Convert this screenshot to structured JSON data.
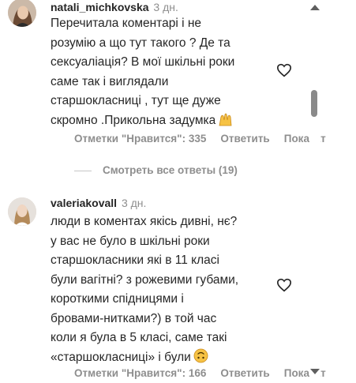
{
  "comments": [
    {
      "username": "natali_michkovska",
      "time": "3 дн.",
      "text": "Перечитала коментарі і не\nрозумію а що тут такого ? Де та\nсексуаліація? В мої шкільні роки\nсаме так і виглядали\nстаршокласниці , тут ще дуже\nскромно .Прикольна задумка",
      "emoji": "raised-hands",
      "likes_label": "Отметки \"Нравится\": 335",
      "reply_label": "Ответить",
      "show_label": "Показат"
    },
    {
      "username": "valeriakovall",
      "time": "3 дн.",
      "text": "люди в коментах якісь дивні, нє?\nу вас не було в шкільні роки\nстаршокласники які в 11 класі\nбули вагітні? з рожевими губами,\nкороткими спідницями і\nбровами-нитками?) в той час\nколи я була в 5 класі, саме такі\n«старшокласниці» і були",
      "emoji": "upside-down-face",
      "likes_label": "Отметки \"Нравится\": 166",
      "reply_label": "Ответить",
      "show_label": "Показат"
    }
  ],
  "view_replies_label": "Смотреть все ответы (19)",
  "icons": {
    "like": "heart-icon",
    "scroll_up": "arrow-up-icon",
    "scroll_down": "arrow-down-icon"
  },
  "colors": {
    "text": "#262626",
    "secondary": "#8e8e8e",
    "emoji_yellow": "#f6c244"
  }
}
